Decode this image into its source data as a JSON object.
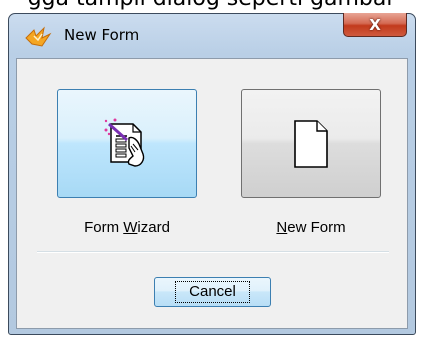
{
  "caption": "gga tampil dialog seperti gambar",
  "window": {
    "title": "New Form",
    "close_glyph": "X",
    "title_icon": "app-logo-icon"
  },
  "buttons": {
    "form_wizard": {
      "label_pre": "Form ",
      "label_mnemonic": "W",
      "label_post": "izard",
      "icon": "form-wizard-icon"
    },
    "new_form": {
      "label_pre": "",
      "label_mnemonic": "N",
      "label_post": "ew Form",
      "icon": "blank-document-icon"
    },
    "cancel": {
      "label": "Cancel"
    }
  },
  "colors": {
    "selected_button_border": "#3c7fb1",
    "close_button": "#c23a1c",
    "frame": "#b9cfe6"
  }
}
